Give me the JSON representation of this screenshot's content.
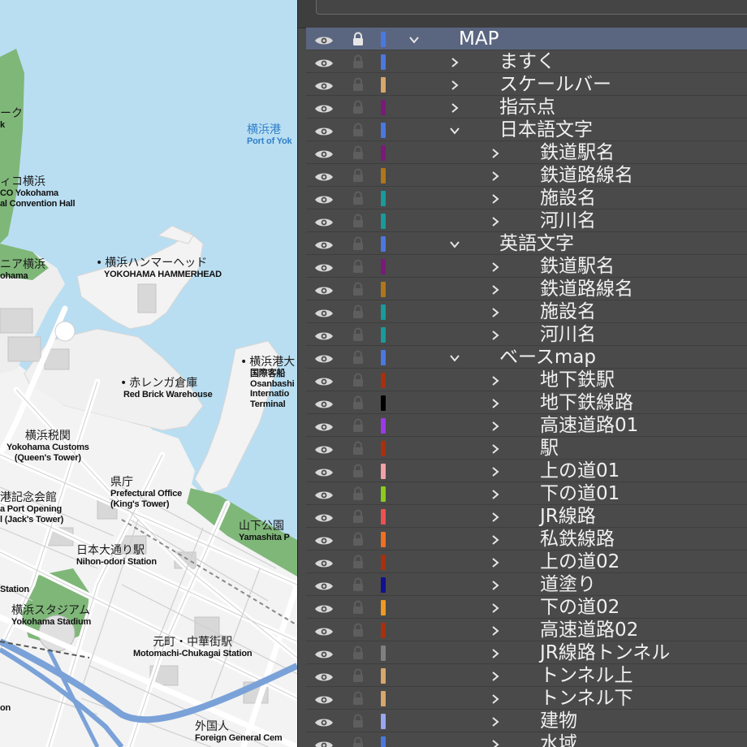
{
  "colors": {
    "water": "#b9def2",
    "land": "#f3f3f3",
    "park": "#7fb779",
    "road": "#ffffff",
    "road_edge": "#c8c8c8",
    "railway": "#7aa2d8",
    "panel_bg": "#4a4a4a",
    "row_selected": "#5a6680",
    "text_light": "#f0f0f0"
  },
  "map": {
    "labels": [
      {
        "id": "park-top",
        "ja": "ーク",
        "en": "k",
        "water": false,
        "bullet": false
      },
      {
        "id": "pacifico",
        "ja": "ィコ横浜",
        "en": "CO Yokohama\nal Convention Hall",
        "water": false,
        "bullet": false
      },
      {
        "id": "port",
        "ja": "横浜港",
        "en": "Port of Yok",
        "water": true,
        "bullet": false
      },
      {
        "id": "hammerhead",
        "ja": "横浜ハンマーヘッド",
        "en": "YOKOHAMA HAMMERHEAD",
        "water": false,
        "bullet": true
      },
      {
        "id": "nia",
        "ja": "ニア横浜",
        "en": "ohama",
        "water": false,
        "bullet": false
      },
      {
        "id": "osanbashi",
        "ja": "横浜港大",
        "en": "国際客船\nOsanbashi\nInternatio\nTerminal",
        "water": false,
        "bullet": true
      },
      {
        "id": "redbrick",
        "ja": "赤レンガ倉庫",
        "en": "Red Brick Warehouse",
        "water": false,
        "bullet": true
      },
      {
        "id": "customs",
        "ja": "横浜税関",
        "en": "Yokohama Customs\n(Queen's Tower)",
        "water": false,
        "bullet": false
      },
      {
        "id": "kencho",
        "ja": "県庁",
        "en": "Prefectural Office\n(King's Tower)",
        "water": false,
        "bullet": false
      },
      {
        "id": "kaikou",
        "ja": "港記念会館",
        "en": "a Port Opening\nl (Jack's Tower)",
        "water": false,
        "bullet": false
      },
      {
        "id": "yamashita",
        "ja": "山下公園",
        "en": "Yamashita P",
        "water": false,
        "bullet": false
      },
      {
        "id": "nihonodori",
        "ja": "日本大通り駅",
        "en": "Nihon-odori Station",
        "water": false,
        "bullet": false
      },
      {
        "id": "station-left",
        "ja": "",
        "en": "Station",
        "water": false,
        "bullet": false
      },
      {
        "id": "stadium",
        "ja": "横浜スタジアム",
        "en": "Yokohama Stadium",
        "water": false,
        "bullet": false
      },
      {
        "id": "motomachi",
        "ja": "元町・中華街駅",
        "en": "Motomachi-Chukagai Station",
        "water": false,
        "bullet": false
      },
      {
        "id": "on",
        "ja": "",
        "en": "on",
        "water": false,
        "bullet": false
      },
      {
        "id": "foreign",
        "ja": "外国人",
        "en": "Foreign General Cem",
        "water": false,
        "bullet": false
      }
    ]
  },
  "panel": {
    "layers": [
      {
        "name": "MAP",
        "indent": 0,
        "expanded": true,
        "selected": true,
        "color": "#4a78e0"
      },
      {
        "name": "ますく",
        "indent": 1,
        "expanded": false,
        "selected": false,
        "color": "#4a78e0"
      },
      {
        "name": "スケールバー",
        "indent": 1,
        "expanded": false,
        "selected": false,
        "color": "#d9a66b"
      },
      {
        "name": "指示点",
        "indent": 1,
        "expanded": false,
        "selected": false,
        "color": "#7a1a7a"
      },
      {
        "name": "日本語文字",
        "indent": 1,
        "expanded": true,
        "selected": false,
        "color": "#4a78e0"
      },
      {
        "name": "鉄道駅名",
        "indent": 2,
        "expanded": false,
        "selected": false,
        "color": "#7a1a7a"
      },
      {
        "name": "鉄道路線名",
        "indent": 2,
        "expanded": false,
        "selected": false,
        "color": "#b0761a"
      },
      {
        "name": "施設名",
        "indent": 2,
        "expanded": false,
        "selected": false,
        "color": "#1a9a9a"
      },
      {
        "name": "河川名",
        "indent": 2,
        "expanded": false,
        "selected": false,
        "color": "#1a9a9a"
      },
      {
        "name": "英語文字",
        "indent": 1,
        "expanded": true,
        "selected": false,
        "color": "#4a78e0"
      },
      {
        "name": "鉄道駅名",
        "indent": 2,
        "expanded": false,
        "selected": false,
        "color": "#7a1a7a"
      },
      {
        "name": "鉄道路線名",
        "indent": 2,
        "expanded": false,
        "selected": false,
        "color": "#b0761a"
      },
      {
        "name": "施設名",
        "indent": 2,
        "expanded": false,
        "selected": false,
        "color": "#1a9a9a"
      },
      {
        "name": "河川名",
        "indent": 2,
        "expanded": false,
        "selected": false,
        "color": "#1a9a9a"
      },
      {
        "name": "ベースmap",
        "indent": 1,
        "expanded": true,
        "selected": false,
        "color": "#4a78e0"
      },
      {
        "name": "地下鉄駅",
        "indent": 2,
        "expanded": false,
        "selected": false,
        "color": "#a8300e"
      },
      {
        "name": "地下鉄線路",
        "indent": 2,
        "expanded": false,
        "selected": false,
        "color": "#000000"
      },
      {
        "name": "高速道路01",
        "indent": 2,
        "expanded": false,
        "selected": false,
        "color": "#9a3ae8"
      },
      {
        "name": "駅",
        "indent": 2,
        "expanded": false,
        "selected": false,
        "color": "#a8300e"
      },
      {
        "name": "上の道01",
        "indent": 2,
        "expanded": false,
        "selected": false,
        "color": "#f2a0a8"
      },
      {
        "name": "下の道01",
        "indent": 2,
        "expanded": false,
        "selected": false,
        "color": "#8acc1a"
      },
      {
        "name": "JR線路",
        "indent": 2,
        "expanded": false,
        "selected": false,
        "color": "#f05050"
      },
      {
        "name": "私鉄線路",
        "indent": 2,
        "expanded": false,
        "selected": false,
        "color": "#f07020"
      },
      {
        "name": "上の道02",
        "indent": 2,
        "expanded": false,
        "selected": false,
        "color": "#a8300e"
      },
      {
        "name": "道塗り",
        "indent": 2,
        "expanded": false,
        "selected": false,
        "color": "#101090"
      },
      {
        "name": "下の道02",
        "indent": 2,
        "expanded": false,
        "selected": false,
        "color": "#f09a20"
      },
      {
        "name": "高速道路02",
        "indent": 2,
        "expanded": false,
        "selected": false,
        "color": "#a8300e"
      },
      {
        "name": "JR線路トンネル",
        "indent": 2,
        "expanded": false,
        "selected": false,
        "color": "#808080"
      },
      {
        "name": "トンネル上",
        "indent": 2,
        "expanded": false,
        "selected": false,
        "color": "#d9a66b"
      },
      {
        "name": "トンネル下",
        "indent": 2,
        "expanded": false,
        "selected": false,
        "color": "#d9a66b"
      },
      {
        "name": "建物",
        "indent": 2,
        "expanded": false,
        "selected": false,
        "color": "#9aa6f0"
      },
      {
        "name": "水域",
        "indent": 2,
        "expanded": false,
        "selected": false,
        "color": "#4a78e0"
      }
    ]
  }
}
